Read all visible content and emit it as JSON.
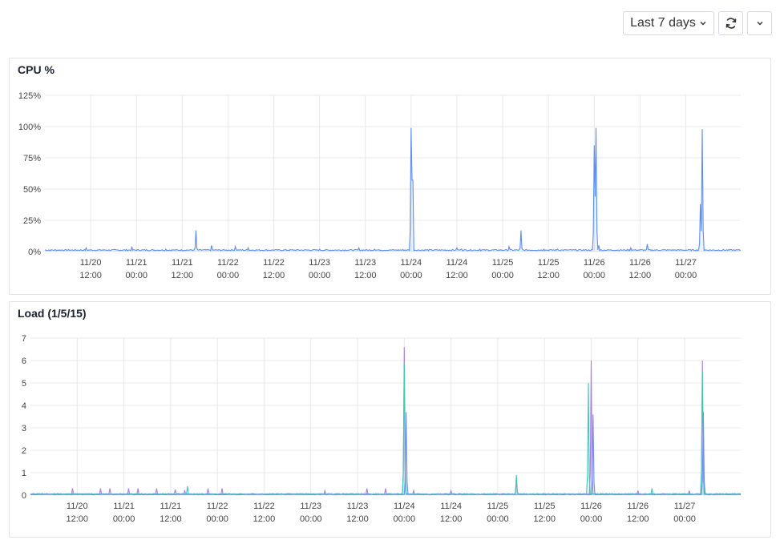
{
  "toolbar": {
    "range_label": "Last 7 days",
    "range_icon": "chevron-down-icon",
    "refresh_icon": "refresh-icon",
    "more_icon": "chevron-down-icon"
  },
  "chart_data": [
    {
      "type": "line",
      "title": "CPU %",
      "ylim": [
        0,
        125
      ],
      "yticks": [
        "0%",
        "25%",
        "50%",
        "75%",
        "100%",
        "125%"
      ],
      "yticks_values": [
        0,
        25,
        50,
        75,
        100,
        125
      ],
      "xlim": [
        0,
        7.6
      ],
      "xticks": [
        {
          "x": 0.5,
          "l1": "11/20",
          "l2": "12:00"
        },
        {
          "x": 1.0,
          "l1": "11/21",
          "l2": "00:00"
        },
        {
          "x": 1.5,
          "l1": "11/21",
          "l2": "12:00"
        },
        {
          "x": 2.0,
          "l1": "11/22",
          "l2": "00:00"
        },
        {
          "x": 2.5,
          "l1": "11/22",
          "l2": "12:00"
        },
        {
          "x": 3.0,
          "l1": "11/23",
          "l2": "00:00"
        },
        {
          "x": 3.5,
          "l1": "11/23",
          "l2": "12:00"
        },
        {
          "x": 4.0,
          "l1": "11/24",
          "l2": "00:00"
        },
        {
          "x": 4.5,
          "l1": "11/24",
          "l2": "12:00"
        },
        {
          "x": 5.0,
          "l1": "11/25",
          "l2": "00:00"
        },
        {
          "x": 5.5,
          "l1": "11/25",
          "l2": "12:00"
        },
        {
          "x": 6.0,
          "l1": "11/26",
          "l2": "00:00"
        },
        {
          "x": 6.5,
          "l1": "11/26",
          "l2": "12:00"
        },
        {
          "x": 7.0,
          "l1": "11/27",
          "l2": "00:00"
        }
      ],
      "grid": true,
      "series": [
        {
          "color": "#5b8ff0",
          "baseline": 1.2,
          "spikes": [
            [
              0.45,
              3
            ],
            [
              0.95,
              4
            ],
            [
              1.32,
              2
            ],
            [
              1.65,
              17
            ],
            [
              1.82,
              5
            ],
            [
              2.08,
              4
            ],
            [
              2.22,
              3
            ],
            [
              3.0,
              2
            ],
            [
              3.43,
              3
            ],
            [
              3.6,
              2
            ],
            [
              4.0,
              99
            ],
            [
              4.015,
              98
            ],
            [
              4.5,
              3
            ],
            [
              4.55,
              2
            ],
            [
              4.75,
              2
            ],
            [
              5.07,
              4
            ],
            [
              5.2,
              17
            ],
            [
              5.45,
              2
            ],
            [
              5.6,
              2
            ],
            [
              6.0,
              85
            ],
            [
              6.01,
              44
            ],
            [
              6.02,
              99
            ],
            [
              6.05,
              5
            ],
            [
              6.4,
              3
            ],
            [
              6.58,
              6
            ],
            [
              7.16,
              38
            ],
            [
              7.18,
              98
            ]
          ]
        }
      ]
    },
    {
      "type": "line",
      "title": "Load (1/5/15)",
      "ylim": [
        0,
        7
      ],
      "yticks": [
        "0",
        "1",
        "2",
        "3",
        "4",
        "5",
        "6",
        "7"
      ],
      "yticks_values": [
        0,
        1,
        2,
        3,
        4,
        5,
        6,
        7
      ],
      "xlim": [
        0,
        7.6
      ],
      "xticks": [
        {
          "x": 0.5,
          "l1": "11/20",
          "l2": "12:00"
        },
        {
          "x": 1.0,
          "l1": "11/21",
          "l2": "00:00"
        },
        {
          "x": 1.5,
          "l1": "11/21",
          "l2": "12:00"
        },
        {
          "x": 2.0,
          "l1": "11/22",
          "l2": "00:00"
        },
        {
          "x": 2.5,
          "l1": "11/22",
          "l2": "12:00"
        },
        {
          "x": 3.0,
          "l1": "11/23",
          "l2": "00:00"
        },
        {
          "x": 3.5,
          "l1": "11/23",
          "l2": "12:00"
        },
        {
          "x": 4.0,
          "l1": "11/24",
          "l2": "00:00"
        },
        {
          "x": 4.5,
          "l1": "11/24",
          "l2": "12:00"
        },
        {
          "x": 5.0,
          "l1": "11/25",
          "l2": "00:00"
        },
        {
          "x": 5.5,
          "l1": "11/25",
          "l2": "12:00"
        },
        {
          "x": 6.0,
          "l1": "11/26",
          "l2": "00:00"
        },
        {
          "x": 6.5,
          "l1": "11/26",
          "l2": "12:00"
        },
        {
          "x": 7.0,
          "l1": "11/27",
          "l2": "00:00"
        }
      ],
      "grid": true,
      "series": [
        {
          "color": "#b07ae8",
          "baseline": 0.05,
          "spikes": [
            [
              0.45,
              0.3
            ],
            [
              0.75,
              0.3
            ],
            [
              0.85,
              0.3
            ],
            [
              1.05,
              0.3
            ],
            [
              1.15,
              0.3
            ],
            [
              1.35,
              0.3
            ],
            [
              1.55,
              0.25
            ],
            [
              1.65,
              0.2
            ],
            [
              1.9,
              0.3
            ],
            [
              2.05,
              0.3
            ],
            [
              3.15,
              0.2
            ],
            [
              3.6,
              0.3
            ],
            [
              3.8,
              0.3
            ],
            [
              4.0,
              6.6
            ],
            [
              4.1,
              0.2
            ],
            [
              4.5,
              0.2
            ],
            [
              5.2,
              0.6
            ],
            [
              6.0,
              6.0
            ],
            [
              6.5,
              0.2
            ],
            [
              7.19,
              6.0
            ],
            [
              7.05,
              0.2
            ]
          ]
        },
        {
          "color": "#3fc9b4",
          "baseline": 0.05,
          "spikes": [
            [
              1.68,
              0.4
            ],
            [
              4.0,
              5.9
            ],
            [
              5.2,
              0.9
            ],
            [
              5.97,
              5.0
            ],
            [
              6.65,
              0.3
            ],
            [
              7.19,
              5.5
            ]
          ]
        },
        {
          "color": "#6e8ff0",
          "baseline": 0.03,
          "spikes": [
            [
              4.02,
              3.7
            ],
            [
              6.02,
              3.6
            ],
            [
              7.2,
              3.7
            ]
          ]
        }
      ]
    }
  ]
}
